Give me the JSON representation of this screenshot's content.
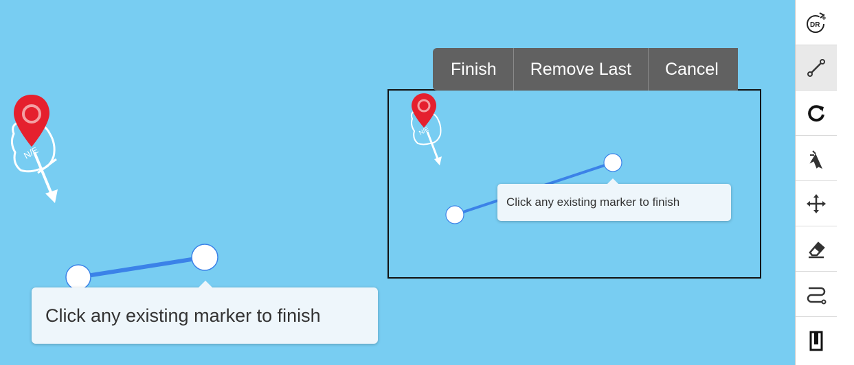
{
  "map": {
    "background": "#78cdf2",
    "polyline_color": "#3b82e8",
    "marker_color": "#e5202e"
  },
  "actions": {
    "finish_label": "Finish",
    "remove_last_label": "Remove Last",
    "cancel_label": "Cancel"
  },
  "tooltip": {
    "main_text": "Click any existing marker to finish",
    "preview_text": "Click any existing marker to finish"
  },
  "toolbar": {
    "tools": [
      {
        "icon": "draw-route-icon",
        "label": "DR"
      },
      {
        "icon": "polyline-icon",
        "active": true
      },
      {
        "icon": "refresh-icon"
      },
      {
        "icon": "pointer-icon"
      },
      {
        "icon": "move-icon"
      },
      {
        "icon": "eraser-icon"
      },
      {
        "icon": "route-icon"
      },
      {
        "icon": "bracket-icon"
      }
    ]
  }
}
